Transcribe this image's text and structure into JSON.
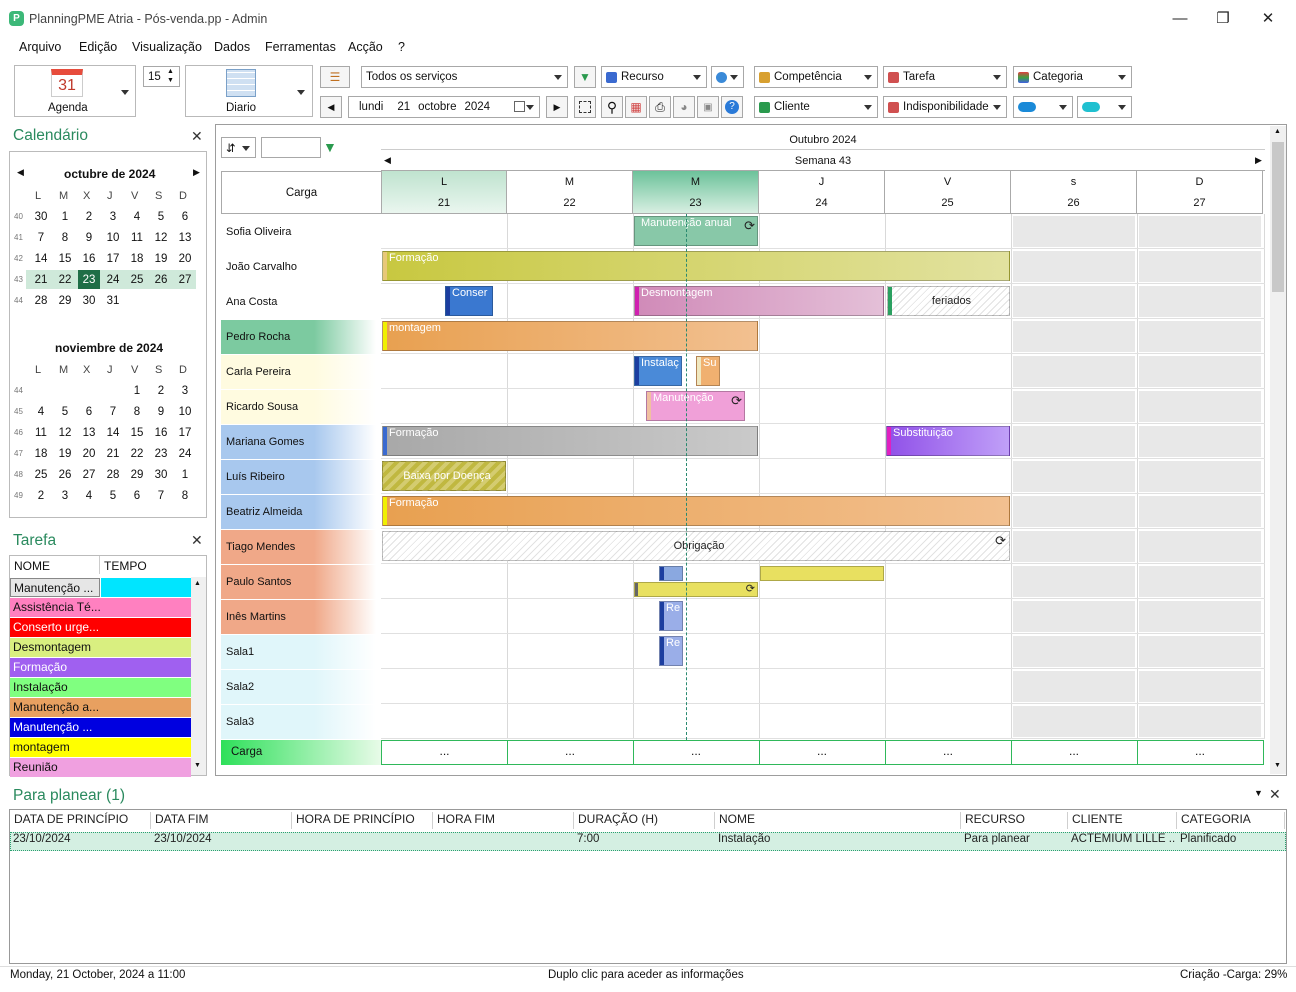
{
  "window": {
    "title": "PlanningPME Atria - Pós-venda.pp - Admin"
  },
  "menu": [
    "Arquivo",
    "Edição",
    "Visualização",
    "Dados",
    "Ferramentas",
    "Acção",
    "?"
  ],
  "toolbar": {
    "agenda_label": "Agenda",
    "agenda_day": "31",
    "zoom_value": "15",
    "view_label": "Diario",
    "services_combo": "Todos os serviços",
    "resource_combo": "Recurso",
    "date_day": "lundi",
    "date_num": "21",
    "date_month": "octobre",
    "date_year": "2024",
    "competence_combo": "Competência",
    "client_combo": "Cliente",
    "task_combo": "Tarefa",
    "unavailability_combo": "Indisponibilidade",
    "category_combo": "Categoria"
  },
  "calendar": {
    "title": "Calendário",
    "dow": [
      "L",
      "M",
      "X",
      "J",
      "V",
      "S",
      "D"
    ],
    "oct": {
      "title": "octubre de 2024",
      "weeks": [
        {
          "wk": "40",
          "days": [
            "30",
            "1",
            "2",
            "3",
            "4",
            "5",
            "6"
          ]
        },
        {
          "wk": "41",
          "days": [
            "7",
            "8",
            "9",
            "10",
            "11",
            "12",
            "13"
          ]
        },
        {
          "wk": "42",
          "days": [
            "14",
            "15",
            "16",
            "17",
            "18",
            "19",
            "20"
          ]
        },
        {
          "wk": "43",
          "days": [
            "21",
            "22",
            "23",
            "24",
            "25",
            "26",
            "27"
          ]
        },
        {
          "wk": "44",
          "days": [
            "28",
            "29",
            "30",
            "31",
            "",
            "",
            ""
          ]
        }
      ]
    },
    "nov": {
      "title": "noviembre de 2024",
      "weeks": [
        {
          "wk": "44",
          "days": [
            "",
            "",
            "",
            "",
            "1",
            "2",
            "3"
          ]
        },
        {
          "wk": "45",
          "days": [
            "4",
            "5",
            "6",
            "7",
            "8",
            "9",
            "10"
          ]
        },
        {
          "wk": "46",
          "days": [
            "11",
            "12",
            "13",
            "14",
            "15",
            "16",
            "17"
          ]
        },
        {
          "wk": "47",
          "days": [
            "18",
            "19",
            "20",
            "21",
            "22",
            "23",
            "24"
          ]
        },
        {
          "wk": "48",
          "days": [
            "25",
            "26",
            "27",
            "28",
            "29",
            "30",
            "1"
          ]
        },
        {
          "wk": "49",
          "days": [
            "2",
            "3",
            "4",
            "5",
            "6",
            "7",
            "8"
          ]
        }
      ]
    }
  },
  "tasks_panel": {
    "title": "Tarefa",
    "col_name": "NOME",
    "col_time": "TEMPO",
    "items": [
      {
        "name": "Manutenção ...",
        "color": "#e6e6e6",
        "swatch": "#00e5ff",
        "dark": false
      },
      {
        "name": "Assistência Té...",
        "color": "#ff80c0",
        "dark": false
      },
      {
        "name": "Conserto urge...",
        "color": "#ff0000",
        "dark": true
      },
      {
        "name": "Desmontagem",
        "color": "#d9ef80",
        "dark": false
      },
      {
        "name": "Formação",
        "color": "#a060f0",
        "dark": true
      },
      {
        "name": "Instalação",
        "color": "#80ff80",
        "dark": false
      },
      {
        "name": "Manutenção a...",
        "color": "#e8a060",
        "dark": false
      },
      {
        "name": "Manutenção ...",
        "color": "#0000e0",
        "dark": true
      },
      {
        "name": "montagem",
        "color": "#ffff00",
        "dark": false
      },
      {
        "name": "Reunião",
        "color": "#f0a0e0",
        "dark": false
      }
    ]
  },
  "planner": {
    "month": "Outubro 2024",
    "week": "Semana 43",
    "load_label": "Carga",
    "days": [
      {
        "letter": "L",
        "num": "21"
      },
      {
        "letter": "M",
        "num": "22"
      },
      {
        "letter": "M",
        "num": "23"
      },
      {
        "letter": "J",
        "num": "24"
      },
      {
        "letter": "V",
        "num": "25"
      },
      {
        "letter": "s",
        "num": "26"
      },
      {
        "letter": "D",
        "num": "27"
      }
    ],
    "resources": [
      {
        "name": "Sofia Oliveira",
        "bg": "#ffffff"
      },
      {
        "name": "João Carvalho",
        "bg": "#ffffff"
      },
      {
        "name": "Ana Costa",
        "bg": "#ffffff"
      },
      {
        "name": "Pedro Rocha",
        "bg": "#7ccaa0"
      },
      {
        "name": "Carla Pereira",
        "bg": "#fffbe0"
      },
      {
        "name": "Ricardo Sousa",
        "bg": "#fffbe0"
      },
      {
        "name": "Mariana Gomes",
        "bg": "#a8c8ee"
      },
      {
        "name": "Luís Ribeiro",
        "bg": "#a8c8ee"
      },
      {
        "name": "Beatriz Almeida",
        "bg": "#a8c8ee"
      },
      {
        "name": "Tiago Mendes",
        "bg": "#f0a888"
      },
      {
        "name": "Paulo Santos",
        "bg": "#f0a888"
      },
      {
        "name": "Inês Martins",
        "bg": "#f0a888"
      },
      {
        "name": "Sala1",
        "bg": "#e0f6fa"
      },
      {
        "name": "Sala2",
        "bg": "#e0f6fa"
      },
      {
        "name": "Sala3",
        "bg": "#e0f6fa"
      }
    ],
    "load_footer": "Carga",
    "load_cells": [
      "...",
      "...",
      "...",
      "...",
      "...",
      "...",
      "..."
    ],
    "events": {
      "manut_anual": "Manutenção anual",
      "formacao1": "Formação",
      "conser": "Conser",
      "desmontagem": "Desmontagem",
      "feriados": "feriados",
      "montagem": "montagem",
      "instalac": "Instalaç",
      "su": "Su",
      "manutencao": "Manutenção",
      "formacao2": "Formação",
      "substituicao": "Substituição",
      "baixa": "Baixa por Doença",
      "formacao3": "Formação",
      "obrigacao": "Obrigação",
      "re1": "Re",
      "re2": "Re"
    }
  },
  "to_plan": {
    "title": "Para planear (1)",
    "columns": [
      "DATA DE PRINCÍPIO",
      "DATA FIM",
      "HORA DE PRINCÍPIO",
      "HORA FIM",
      "DURAÇÃO (H)",
      "NOME",
      "RECURSO",
      "CLIENTE",
      "CATEGORIA"
    ],
    "rows": [
      [
        "23/10/2024",
        "23/10/2024",
        "",
        "",
        "7:00",
        "Instalação",
        "Para planear",
        "ACTEMIUM LILLE ...",
        "Planificado"
      ]
    ]
  },
  "status": {
    "left": "Monday, 21 October, 2024 a 11:00",
    "center": "Duplo clic para aceder as informações",
    "right": "Criação -Carga: 29%"
  }
}
